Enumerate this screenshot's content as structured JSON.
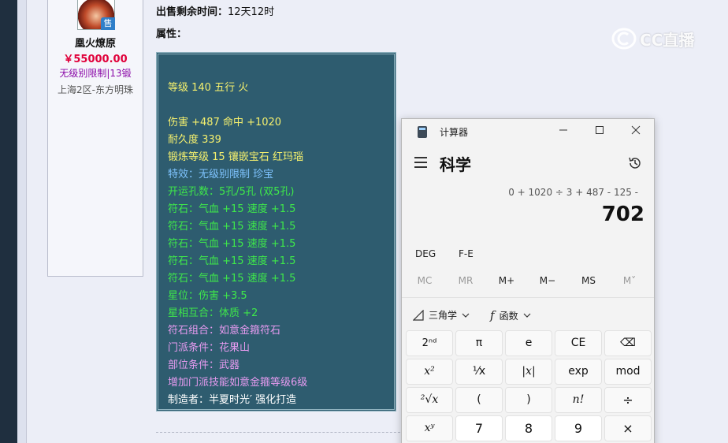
{
  "seller": {
    "sale_tag": "售",
    "name": "凰火燎原",
    "price": "￥55000.00",
    "level": "无级别限制|13锻",
    "server": "上海2区-东方明珠"
  },
  "listing": {
    "time_left_label": "出售剩余时间：",
    "time_left_value": "12天12时",
    "attributes_label": "属性："
  },
  "item_lines": [
    {
      "text": "等级 140 五行 火",
      "color": "#f5f06e"
    },
    {
      "text": "伤害 +487 命中 +1020",
      "color": "#f5f06e"
    },
    {
      "text": "耐久度 339",
      "color": "#f5f06e"
    },
    {
      "text": "锻炼等级 15 镶嵌宝石 红玛瑙",
      "color": "#f5f06e"
    },
    {
      "text": "特效：无级别限制 珍宝",
      "color": "#7fc4ff"
    },
    {
      "text": "开运孔数：5孔/5孔 (双5孔)",
      "color": "#3ee84a"
    },
    {
      "text": "符石：气血 +15 速度 +1.5",
      "color": "#3ee84a"
    },
    {
      "text": "符石：气血 +15 速度 +1.5",
      "color": "#3ee84a"
    },
    {
      "text": "符石：气血 +15 速度 +1.5",
      "color": "#3ee84a"
    },
    {
      "text": "符石：气血 +15 速度 +1.5",
      "color": "#3ee84a"
    },
    {
      "text": "符石：气血 +15 速度 +1.5",
      "color": "#3ee84a"
    },
    {
      "text": "星位：伤害 +3.5",
      "color": "#3ee84a"
    },
    {
      "text": "星相互合：体质 +2",
      "color": "#3ee84a"
    },
    {
      "text": "符石组合：如意金箍符石",
      "color": "#e79bf0"
    },
    {
      "text": "门派条件：花果山",
      "color": "#e79bf0"
    },
    {
      "text": "部位条件：武器",
      "color": "#e79bf0"
    },
    {
      "text": "增加门派技能如意金箍等级6级",
      "color": "#e79bf0"
    },
    {
      "text": "制造者：半夏时光′ 强化打造",
      "color": "#ffffff"
    }
  ],
  "watermark": {
    "text": "CC直播"
  },
  "calculator": {
    "title": "计算器",
    "mode": "科学",
    "expression": "0 + 1020 ÷ 3 + 487 - 125 -",
    "result": "702",
    "angle_mode": "DEG",
    "fe_label": "F-E",
    "memory": [
      "MC",
      "MR",
      "M+",
      "M−",
      "MS",
      "M˅"
    ],
    "trig_label": "三角学",
    "func_label": "函数",
    "keys": [
      [
        "2ⁿᵈ",
        "π",
        "e",
        "CE",
        "⌫"
      ],
      [
        "x²",
        "¹⁄x",
        "|x|",
        "exp",
        "mod"
      ],
      [
        "²√x",
        "(",
        ")",
        "n!",
        "÷"
      ],
      [
        "xʸ",
        "7",
        "8",
        "9",
        "×"
      ]
    ]
  }
}
